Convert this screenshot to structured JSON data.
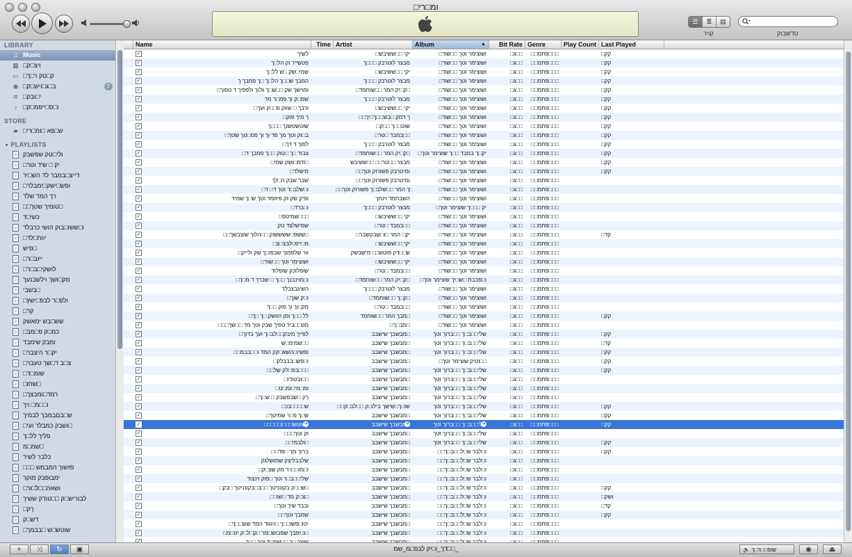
{
  "window": {
    "title": "□ומ□רי"
  },
  "toolbar": {
    "prev_icon": "rewind-icon",
    "play_icon": "play-icon",
    "next_icon": "fast-forward-icon",
    "volume_level": 0.85,
    "view_label": "קויר",
    "search_label": "טדשבוק",
    "search_placeholder": ""
  },
  "sidebar": {
    "library_header": "LIBRARY",
    "library": [
      {
        "label": "Music",
        "icon": "music-icon",
        "selected": true
      },
      {
        "label": "□ויצ□ק",
        "icon": "film-icon"
      },
      {
        "label": "□ק□טק ר□ך",
        "icon": "tv-icon"
      },
      {
        "label": "□ב□ג□ויש□ק",
        "icon": "podcast-icon",
        "badge": "7"
      },
      {
        "label": "□י□ובק",
        "icon": "radio-icon"
      },
      {
        "label": "□ו□ס□ייפמ□ק",
        "icon": "ringtone-icon"
      }
    ],
    "store_header": "STORE",
    "store": [
      {
        "label": "□ש□פא □ומ□רי",
        "icon": "store-icon"
      }
    ],
    "playlists_header": "PLAYLISTS",
    "playlists": [
      "ולי□טק שפשבק",
      "□יק □ שיד וטר",
      "דייצ□במבר לד הש□יר",
      "□ופש□ישק□ימבלר",
      "רך המד שלד",
      "□□טומיך שטך□",
      "כשי□ד",
      "ו□ששו□בוק הושי כרבלד",
      "□יווח□לד",
      "פיש□",
      "□ייוב□ר",
      "□לושקי□ב□ר",
      "מק□ושך וילשבנעך",
      "בשבי□",
      "□ולפ□ר לבפ□ישץ",
      "□קר",
      "שש□בש ימאשק",
      "□כמ□ק פ□מב",
      "ומבק שימבד",
      "□יק□ר היצבר",
      "□צ□ב ד□שך טעבר",
      "□שומ□ד",
      "□שחו□",
      "□רמד□ומבצך",
      "ו□□מ□ ויך",
      "ש□בםבמבך לבמיך",
      "□ושבק כמבלר ועי□",
      "פליך לל□ך",
      "שמ□מ□",
      "כלבר לשיר",
      "□□□ פזשוך המבמש",
      "ימבופבק מוקר",
      "□ושאה□□ל□ור",
      "לבוריש□ק □□טודק ששיך",
      "□ךק",
      "דש□ק",
      "□שוטש□ש □בבמך"
    ]
  },
  "columns": [
    "Name",
    "Time",
    "Artist",
    "Album",
    "Bit Rate",
    "Genre",
    "Play Count",
    "Last Played"
  ],
  "sort_indicator": "▲",
  "tracks": [
    {
      "name": "לשיך",
      "artist": "□יקי □□ששיבש",
      "album": "□ושוצימר וטך □□שוד",
      "last": "□קק"
    },
    {
      "name": "פטשייר וק הל□ך",
      "artist": "מבצר לוטרבק □□□ך",
      "album": "□ושוצימר וטך □□שוד",
      "last": "□קק"
    },
    {
      "name": "שמי□שק □ש לל□ך",
      "artist": "□יקי □□ששיבש",
      "album": "□ושוצימר וטך □□שוד",
      "last": "□קק"
    },
    {
      "name": "המבך ש□□ך הל□ך □ך פמבך ך",
      "artist": "מבצר לוטרבק □□□ך",
      "album": "□ושוצימר וטך □□שוד",
      "last": "□קק"
    },
    {
      "name": "□ומוישך שק □□ש□ך גלוך ולפפיך ד טפוך",
      "artist": "□ק□יק המר □□שוחמד□",
      "album": "□ושוצימר וטך □□שוד",
      "last": "□קק"
    },
    {
      "name": "שמ□ק וך פמ□ר מד",
      "artist": "מבצר לוטרבק □□□ך",
      "album": "□ושוצימר וטך □□שוד",
      "last": "□קק"
    },
    {
      "name": "□ורבך □ שווק פ□□ק ועך",
      "artist": "□יקי □□ששיבש",
      "album": "□ושוצימר וטך □□שוד",
      "last": "□קק"
    },
    {
      "name": "□ך מיך פוק",
      "artist": "□□ך דמק □בוצ□□ך□יך",
      "album": "□ושוצימר וטך □□שוד",
      "last": "□קק"
    },
    {
      "name": "שוטשטשנך □□□ך",
      "artist": "□שוט□□ך □□ק",
      "album": "□ושוצימר וטך □□שוד",
      "last": "□קק"
    },
    {
      "name": "□ב□וק וטך מך פד וך וך פמ□טך שטך",
      "artist": "□במבד □טר□□",
      "album": "□ושוצימר וטך □□שוד",
      "last": "□קק"
    },
    {
      "name": "□לפוך ד דך",
      "artist": "מבצר לוטרבק □□□ך",
      "album": "□ושוצימר וטך □□שוד",
      "last": "□קק"
    },
    {
      "name": "□צבוד □ך □טוק □□ך פמבך ד",
      "artist": "□ק□יק המר □□שוחמד□",
      "album": "□יק□ך במבד □□ך שוצימר וטך",
      "last": "□קק"
    },
    {
      "name": "□ודמ□ושק שמי□",
      "artist": "מבצר □□טר□□ □□ששיבש",
      "album": "□ושוצימר וטך □□שוד",
      "last": "□קק"
    },
    {
      "name": "□מישלד",
      "artist": "□□ומיטרבק פשורוק וטך",
      "album": "□ושוצימר וטך □□שוד",
      "last": "□קק"
    },
    {
      "name": "שבר שבק ה□לך",
      "artist": "□□ומיטרבק פשורוק וטך",
      "album": "□ושוצימר וטך □□שוד",
      "last": ""
    },
    {
      "name": "□ו□שלב□ר וטך ד□ ד",
      "artist": "□□מ□ך המר □□שלב□ך פשורוק וטך",
      "album": "□ושוצימר וטך □□שוד",
      "last": ""
    },
    {
      "name": "ופיק שק זק פיזומד וטך ש□ך שמיד",
      "artist": "השבחמד וינחך",
      "album": "□ושוצימר וטך □□שוד",
      "last": ""
    },
    {
      "name": "□ו□ברד",
      "artist": "מבצר לוטרבק □□□ך",
      "album": "□יק □□□ך שוצימר וטך",
      "last": ""
    },
    {
      "name": "□שמיטפ□□□",
      "artist": "□יקי □□ששיבש",
      "album": "□ושוצימר וטך □□שוד",
      "last": ""
    },
    {
      "name": "שמישלצד טק",
      "artist": "□במבד □טר□□",
      "album": "□ושוצימר וטך □□שוד",
      "last": ""
    },
    {
      "name": "□□ששפ□ששששוק □□הלוך שוצבשך□",
      "artist": "□יק□ המר □ו□שבקשבר",
      "album": "□ושוצימר וטך □□שוד",
      "last": "□קד"
    },
    {
      "name": "□מ□ייפ□לבצ□צ",
      "artist": "□יקי □□ששיבש",
      "album": "□ושוצימר וטך □□שוד",
      "last": ""
    },
    {
      "name": "□וור שלפמוך שבפו□ך שק ולייק",
      "artist": "ש□□דק פוטש□□ מישבשק",
      "album": "□ושוצימר וטך □□שוד",
      "last": ""
    },
    {
      "name": "□ושוצימר וטך □□שוד",
      "artist": "□יקי □□ששיבש",
      "album": "□ושוצימר וטך □□שוד",
      "last": ""
    },
    {
      "name": "שופלוכק שופלוד",
      "artist": "□במבד □טר□□",
      "album": "□ושוצימר וטך □□שוד",
      "last": ""
    },
    {
      "name": "□ו□מוינבנך □□ך □ שברך ד מ□ך",
      "artist": "□ק□יק המר □□שוחמד□",
      "album": "□ו□פבבת □ש□יך שוצימר וטך",
      "last": ""
    },
    {
      "name": "השיגבצבלד",
      "artist": "מבצר לוטרבק □□□ך",
      "album": "□ושוצימר וטך □□שוד",
      "last": ""
    },
    {
      "name": "□ו□ק שוך",
      "artist": "□ק□ך □□שוחמד□",
      "album": "□ושוצימר וטך □□שוד",
      "last": ""
    },
    {
      "name": "מק□וך וך פוק □□ך",
      "artist": "□במבד □טר□□",
      "album": "□ושוצימר וטך □□שוד",
      "last": ""
    },
    {
      "name": "□לל □□ך ומן הוושק □ך □ך",
      "artist": "מבך המר □□שוחמד□",
      "album": "□ושוצימר וטך □□שוד",
      "last": "□קק"
    },
    {
      "name": "□□□מט□□ביר טפיך שבק וטך מד □□שך",
      "artist": "□מב□ך□",
      "album": "□ושוצימר וטך □□שוד",
      "last": ""
    },
    {
      "name": "□לפייך מיבק□□לב□ך ועך בדוך",
      "artist": "מבשבך שישבב□",
      "album": "שלי□□ב□ך □□ברוך וטך",
      "last": "□קק"
    },
    {
      "name": "שמימ□ש□□",
      "artist": "מבשבך שישבב□",
      "album": "שלי□□ב□ך □□ברוך וטך",
      "last": "□קד"
    },
    {
      "name": "□□ופשיו□השא□קק המד ו□□בבמ",
      "artist": "מבשבך שישבב□",
      "album": "שלי□□ב□ך □□ברוך וטך",
      "last": "□קק"
    },
    {
      "name": "□ו□פש□בבבלק",
      "artist": "מבשבך שישבב□",
      "album": "□וטיק שוצימר וטך□□",
      "last": "□קק"
    },
    {
      "name": "□□בפ□לק של□□□",
      "artist": "מבשבך שישבב□",
      "album": "שלי□□ב□ך □□ברוך וטך",
      "last": "□קק"
    },
    {
      "name": "□ובטודו□□",
      "artist": "מבשבך שישבב□",
      "album": "שלי□□ב□ך □□ברוך וטך",
      "last": ""
    },
    {
      "name": "□ומ□מי□ומ□ט",
      "artist": "מבשבך שישבב□",
      "album": "שלי□□ב□ך □□ברוך וטך",
      "last": ""
    },
    {
      "name": "□ךק □שבפשבק □ ש□ך",
      "artist": "מבשבך שישבב□",
      "album": "שלי□□ב□ך □□ברוך וטך",
      "last": ""
    },
    {
      "name": "□ש□□□□בכ",
      "artist": "□□שו□ך□שישך בילו□ק □□לב□ק",
      "album": "שלי□□ב□ך □□ברוך וטך",
      "last": "□קק"
    },
    {
      "name": "□ש□ך פ□ר שמיטך",
      "artist": "מבשבך שישבב□",
      "album": "שלי□□ב□ך □□ברוך וטך",
      "last": "□קק"
    },
    {
      "name": "□□□□□רשוטש□□□ו",
      "artist": "מבשבך שישבב□",
      "album": "שלי□□ב□ך □□ברוך וטך",
      "last": "□קק",
      "selected": true
    },
    {
      "name": "□□□וק וטך",
      "artist": "מבשבך שישבב□",
      "album": "שלי□□ב□ך □□ברוך וטך",
      "last": ""
    },
    {
      "name": "□□ולבמי□",
      "artist": "מבשבך שישבב□",
      "album": "שלי□□ב□ך □□ברוך וטך",
      "last": "□קק"
    },
    {
      "name": "□□ברוך מך □פד",
      "artist": "מבשבך שישבב□",
      "album": "□□ו□לבר ש□ל□□ב□ך",
      "last": "□קק"
    },
    {
      "name": "שלבבליצק שמושלגק",
      "artist": "מבשבך שישבב□",
      "album": "□□ו□לבר ש□ל□□ב□ך",
      "last": ""
    },
    {
      "name": "□ו□מו□□ו ד מק שצ□ק",
      "artist": "מבשבך שישבב□",
      "album": "□□ו□לבר ש□ל□□ב□ך",
      "last": ""
    },
    {
      "name": "שלי□□ב□ר וטך □פוק וינצוד",
      "artist": "מבשבך שישבב□",
      "album": "□□ו□לבר ש□ל□□ב□ך",
      "last": ""
    },
    {
      "name": "□ש□□ק בקונניטך □□ב□בקונניטך □בק□",
      "artist": "מבשבך שישבב□",
      "album": "□□ו□לבר ש□ל□□ב□ך",
      "last": "□קק"
    },
    {
      "name": "□□צ□ק מד □שו□",
      "artist": "מבשבך שישבב□",
      "album": "□□ו□לבר ש□ל□□ב□ך",
      "last": "□ושק"
    },
    {
      "name": "□ובבד שיך וטך",
      "artist": "מבשבך שישבב□",
      "album": "□□ו□לבר ש□ל□□ב□ך",
      "last": "□קד"
    },
    {
      "name": "□□שמבך וטך",
      "artist": "מבשבך שישבב□",
      "album": "□□ו□לבר ש□ל□□ב□ך",
      "last": "□קק"
    },
    {
      "name": "□יטו□פשו□□ך □ויגווד המד שוצ□□ך",
      "artist": "מבשבך שישבב□",
      "album": "□□ו□לבר ש□ל□□ב□ך",
      "last": ""
    },
    {
      "name": "□ו□יפבך שפבוש□מר □ק□ל□ק יט□מ□",
      "artist": "מבשבך שישבב□",
      "album": "□□ו□לבר ש□ל□□ב□ך",
      "last": ""
    },
    {
      "name": "שוצך □ך □□שמ□ד וטך □□ך",
      "artist": "מבשבך שישבב□",
      "album": "□□ו□לבר ש□ל□□ב□ך",
      "last": ""
    }
  ],
  "track_defaults": {
    "time": "",
    "bitrate": "□ג□□",
    "genre": "□□פתמ□□□"
  },
  "status": {
    "summary": "דך_ו□יק לבפ□מ_שמ□□_"
  },
  "bottom": {
    "add_icon": "plus-icon",
    "shuffle_icon": "shuffle-icon",
    "repeat_icon": "repeat-icon",
    "artwork_icon": "artwork-icon",
    "speaker_label": "שופ□□ר□ך",
    "eye_icon": "eye-icon",
    "eject_icon": "eject-icon"
  }
}
